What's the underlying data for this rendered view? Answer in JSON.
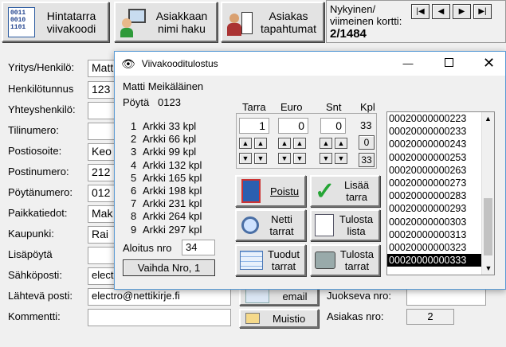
{
  "toolbar": {
    "barcode_btn": "Hintatarra viivakoodi",
    "customer_search_btn": "Asiakkaan nimi haku",
    "customer_events_btn": "Asiakas tapahtumat",
    "card_label": "Nykyinen/ viimeinen kortti:",
    "card_value": "2/1484"
  },
  "form": {
    "labels": {
      "company": "Yritys/Henkilö:",
      "personid": "Henkilötunnus",
      "contact": "Yhteyshenkilö:",
      "account": "Tilinumero:",
      "address": "Postiosoite:",
      "zip": "Postinumero:",
      "table": "Pöytänumero:",
      "location": "Paikkatiedot:",
      "city": "Kaupunki:",
      "extra_table": "Lisäpöytä",
      "email": "Sähköposti:",
      "sender_email": "Lähtevä posti:",
      "comment": "Kommentti:",
      "serial": "Juokseva nro:",
      "customer_no": "Asiakas nro:"
    },
    "values": {
      "company": "Matt",
      "personid": "123",
      "address": "Keo",
      "zip": "212",
      "table": "012",
      "location": "Mak",
      "city": "Rai",
      "email": "electr",
      "sender_email": "electro@nettikirje.fi",
      "comment": "",
      "customer_no": "2"
    },
    "email_btn": "email",
    "notes_btn": "Muistio"
  },
  "dialog": {
    "title": "Viivakooditulostus",
    "customer_name": "Matti Meikäläinen",
    "table_label": "Pöytä",
    "table_value": "0123",
    "col_headers": [
      "Tarra",
      "Euro",
      "Snt",
      "Kpl"
    ],
    "tarra_value": "1",
    "euro_value": "0",
    "snt_value": "0",
    "kpl_value": "33",
    "kpl_btn_small": "0",
    "kpl_btn_big": "33",
    "sheets": [
      {
        "n": "1",
        "label": "Arkki 33 kpl"
      },
      {
        "n": "2",
        "label": "Arkki 66 kpl"
      },
      {
        "n": "3",
        "label": "Arkki 99 kpl"
      },
      {
        "n": "4",
        "label": "Arkki 132 kpl"
      },
      {
        "n": "5",
        "label": "Arkki 165 kpl"
      },
      {
        "n": "6",
        "label": "Arkki 198 kpl"
      },
      {
        "n": "7",
        "label": "Arkki 231 kpl"
      },
      {
        "n": "8",
        "label": "Arkki 264 kpl"
      },
      {
        "n": "9",
        "label": "Arkki 297 kpl"
      }
    ],
    "start_label": "Aloitus nro",
    "start_value": "34",
    "change_btn": "Vaihda Nro, 1",
    "buttons": {
      "exit": "Poistu",
      "add": "Lisää tarra",
      "net": "Netti tarrat",
      "print_list": "Tulosta lista",
      "products": "Tuodut tarrat",
      "print": "Tulosta tarrat"
    },
    "codes": [
      "00020000000223",
      "00020000000233",
      "00020000000243",
      "00020000000253",
      "00020000000263",
      "00020000000273",
      "00020000000283",
      "00020000000293",
      "00020000000303",
      "00020000000313",
      "00020000000323",
      "00020000000333"
    ],
    "selected_code": "00020000000333"
  }
}
